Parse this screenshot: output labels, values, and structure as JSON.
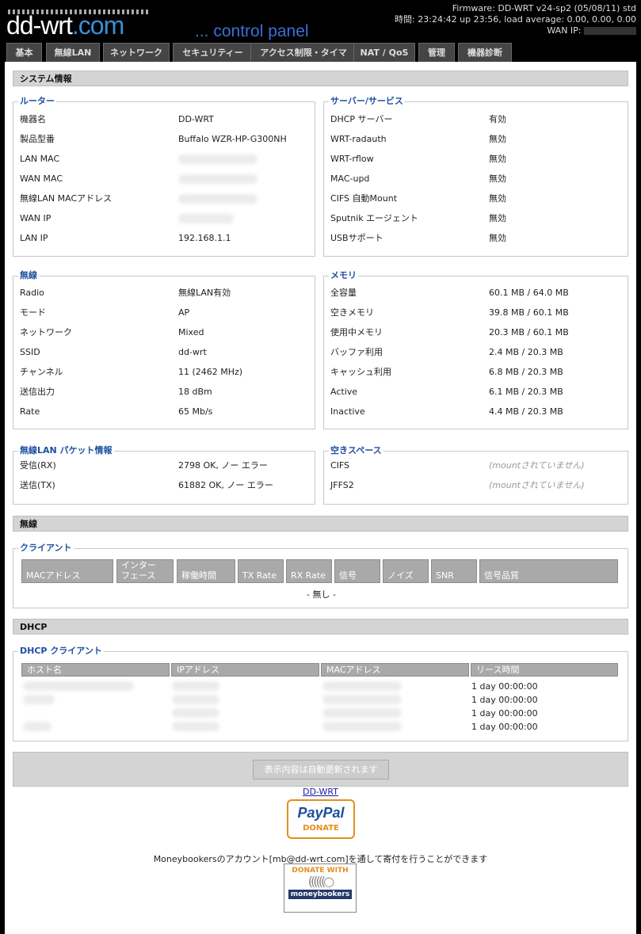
{
  "header": {
    "logo_main": "dd-wrt",
    "logo_suffix": ".com",
    "subtitle": "... control panel",
    "firmware": "Firmware: DD-WRT v24-sp2 (05/08/11) std",
    "time_line": "時間: 23:24:42 up 23:56, load average: 0.00, 0.00, 0.00",
    "wan_ip_label": "WAN IP:"
  },
  "tabs": [
    "基本",
    "無線LAN",
    "ネットワーク",
    "セキュリティー",
    "アクセス制限・タイマ",
    "NAT / QoS",
    "管理",
    "機器診断"
  ],
  "sys_info": {
    "title": "システム情報",
    "router": {
      "legend": "ルーター",
      "rows": [
        {
          "label": "機器名",
          "value": "DD-WRT"
        },
        {
          "label": "製品型番",
          "value": "Buffalo WZR-HP-G300NH"
        },
        {
          "label": "LAN MAC",
          "value": ""
        },
        {
          "label": "WAN MAC",
          "value": ""
        },
        {
          "label": "無線LAN MACアドレス",
          "value": ""
        },
        {
          "label": "WAN IP",
          "value": ""
        },
        {
          "label": "LAN IP",
          "value": "192.168.1.1"
        }
      ]
    },
    "services": {
      "legend": "サーバー/サービス",
      "rows": [
        {
          "label": "DHCP サーバー",
          "value": "有効"
        },
        {
          "label": "WRT-radauth",
          "value": "無効"
        },
        {
          "label": "WRT-rflow",
          "value": "無効"
        },
        {
          "label": "MAC-upd",
          "value": "無効"
        },
        {
          "label": "CIFS 自動Mount",
          "value": "無効"
        },
        {
          "label": "Sputnik エージェント",
          "value": "無効"
        },
        {
          "label": "USBサポート",
          "value": "無効"
        }
      ]
    },
    "wireless": {
      "legend": "無線",
      "rows": [
        {
          "label": "Radio",
          "value": "無線LAN有効"
        },
        {
          "label": "モード",
          "value": "AP"
        },
        {
          "label": "ネットワーク",
          "value": "Mixed"
        },
        {
          "label": "SSID",
          "value": "dd-wrt"
        },
        {
          "label": "チャンネル",
          "value": "11 (2462 MHz)"
        },
        {
          "label": "送信出力",
          "value": "18 dBm"
        },
        {
          "label": "Rate",
          "value": "65 Mb/s"
        }
      ]
    },
    "memory": {
      "legend": "メモリ",
      "rows": [
        {
          "label": "全容量",
          "value": "60.1 MB / 64.0 MB"
        },
        {
          "label": "空きメモリ",
          "value": "39.8 MB / 60.1 MB"
        },
        {
          "label": "使用中メモリ",
          "value": "20.3 MB / 60.1 MB"
        },
        {
          "label": "バッファ利用",
          "value": "2.4 MB / 20.3 MB"
        },
        {
          "label": "キャッシュ利用",
          "value": "6.8 MB / 20.3 MB"
        },
        {
          "label": "Active",
          "value": "6.1 MB / 20.3 MB"
        },
        {
          "label": "Inactive",
          "value": "4.4 MB / 20.3 MB"
        }
      ]
    },
    "packets": {
      "legend": "無線LAN パケット情報",
      "rows": [
        {
          "label": "受信(RX)",
          "value": "2798 OK, ノー エラー"
        },
        {
          "label": "送信(TX)",
          "value": "61882 OK, ノー エラー"
        }
      ]
    },
    "space": {
      "legend": "空きスペース",
      "rows": [
        {
          "label": "CIFS",
          "value": "(mountされていません)"
        },
        {
          "label": "JFFS2",
          "value": "(mountされていません)"
        }
      ]
    }
  },
  "wireless_section": {
    "title": "無線",
    "clients_legend": "クライアント",
    "columns": [
      "MACアドレス",
      "インター\nフェース",
      "稼働時間",
      "TX Rate",
      "RX Rate",
      "信号",
      "ノイズ",
      "SNR",
      "信号品質"
    ],
    "empty": "- 無し -"
  },
  "dhcp_section": {
    "title": "DHCP",
    "legend": "DHCP クライアント",
    "columns": [
      "ホスト名",
      "IPアドレス",
      "MACアドレス",
      "リース時間"
    ],
    "rows": [
      {
        "lease": "1 day 00:00:00"
      },
      {
        "lease": "1 day 00:00:00"
      },
      {
        "lease": "1 day 00:00:00"
      },
      {
        "lease": "1 day 00:00:00"
      }
    ]
  },
  "footer": {
    "refresh_button": "表示内容は自動更新されます",
    "link": "DD-WRT",
    "paypal_brand": "PayPal",
    "paypal_donate": "DONATE",
    "moneybookers_text": "Moneybookersのアカウント[mb@dd-wrt.com]を通して寄付を行うことができます",
    "mb_donate_with": "DONATE WITH",
    "mb_brand": "moneybookers"
  }
}
